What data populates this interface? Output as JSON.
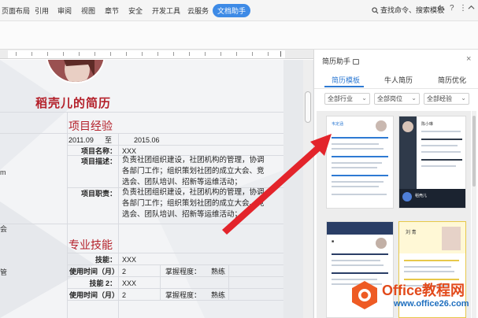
{
  "menu": {
    "items": [
      "页面布局",
      "引用",
      "审阅",
      "视图",
      "章节",
      "安全",
      "开发工具",
      "云服务"
    ],
    "active": "文档助手",
    "search": "查找命令、搜索模板"
  },
  "document": {
    "resume_title": "稻壳儿的简历",
    "section_experience": "项目经验",
    "date_start": "2011.09",
    "date_to": "至",
    "date_end": "2015.06",
    "project_name_label": "项目名称：",
    "project_name_value": "XXX",
    "project_desc_label": "项目描述：",
    "project_desc_lines": [
      "负责社团组织建设，社团机构的管理，协调",
      "各部门工作；组织策划社团的成立大会、竞",
      "选会、团队培训、招新等运维活动；"
    ],
    "project_duty_label": "项目职责：",
    "project_duty_lines": [
      "负责社团组织建设，社团机构的管理，协调",
      "各部门工作；组织策划社团的成立大会、竞",
      "选会、团队培训、招新等运维活动；"
    ],
    "section_skills": "专业技能",
    "skill1_label": "技能：",
    "skill1_value": "XXX",
    "time1_label": "使用时间（月）",
    "time1_value": "2",
    "level1_label": "掌握程度：",
    "level1_value": "熟练",
    "skill2_label": "技能 2：",
    "skill2_value": "XXX",
    "time2_label": "使用时间（月）",
    "time2_value": "2",
    "level2_label": "掌握程度：",
    "level2_value": "熟练",
    "left_fragments": [
      "m",
      "会",
      "管"
    ]
  },
  "pane": {
    "title": "简历助手",
    "tabs": [
      "简历模板",
      "牛人简历",
      "简历优化"
    ],
    "active_tab": "简历模板",
    "filters": [
      "全部行业",
      "全部岗位",
      "全部经验"
    ],
    "thumb_names": [
      "韦定涵",
      "陈小琳",
      "稻壳儿",
      "刘 青"
    ]
  },
  "watermark": {
    "title": "Office教程网",
    "url": "www.office26.com"
  },
  "colors": {
    "accent": "#3d8ae6",
    "resume_red": "#b4202a",
    "arrow_red": "#e3242b",
    "watermark_orange": "#e24a1b"
  }
}
